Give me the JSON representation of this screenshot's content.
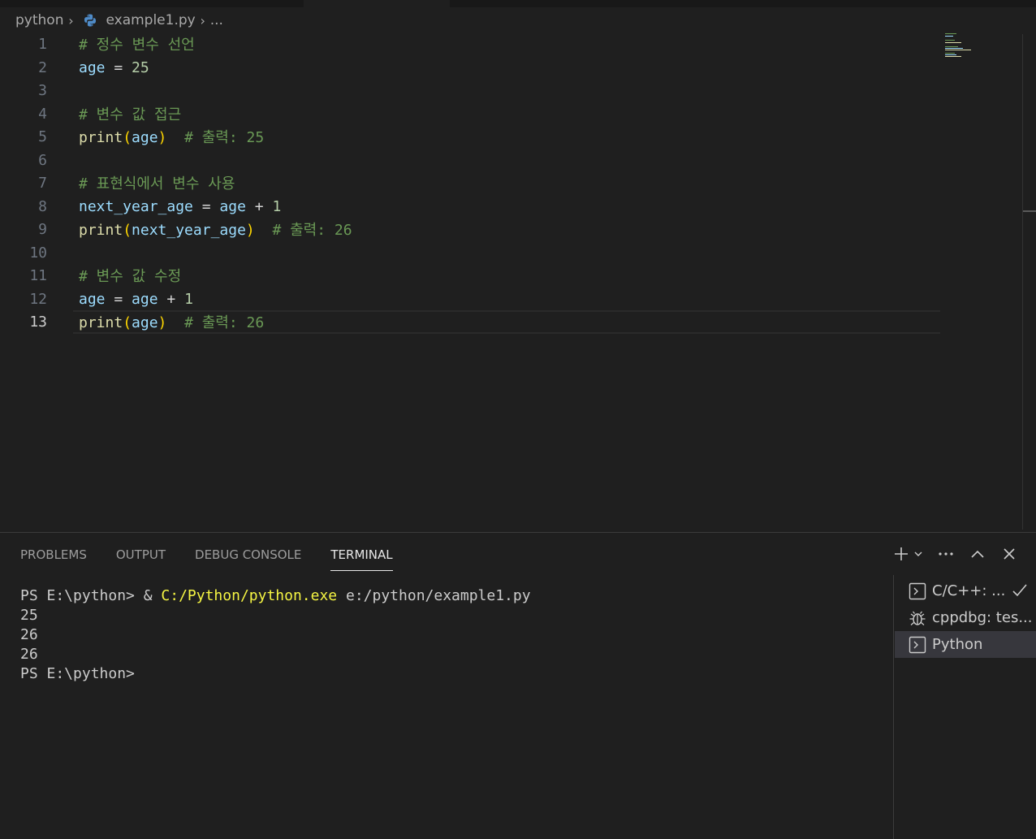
{
  "breadcrumb": {
    "folder": "python",
    "file": "example1.py",
    "more": "...",
    "file_icon": "python-file-icon"
  },
  "editor": {
    "current_line": 13,
    "lines": [
      {
        "n": "1",
        "text": "# 정수 변수 선언"
      },
      {
        "n": "2",
        "text": "age = 25"
      },
      {
        "n": "3",
        "text": ""
      },
      {
        "n": "4",
        "text": "# 변수 값 접근"
      },
      {
        "n": "5",
        "text": "print(age)  # 출력: 25"
      },
      {
        "n": "6",
        "text": ""
      },
      {
        "n": "7",
        "text": "# 표현식에서 변수 사용"
      },
      {
        "n": "8",
        "text": "next_year_age = age + 1"
      },
      {
        "n": "9",
        "text": "print(next_year_age)  # 출력: 26"
      },
      {
        "n": "10",
        "text": ""
      },
      {
        "n": "11",
        "text": "# 변수 값 수정"
      },
      {
        "n": "12",
        "text": "age = age + 1"
      },
      {
        "n": "13",
        "text": "print(age)  # 출력: 26"
      }
    ],
    "tokens": {
      "l1": "# 정수 변수 선언",
      "l2_var": "age",
      "l2_op": " = ",
      "l2_num": "25",
      "l4": "# 변수 값 접근",
      "l5_fn": "print",
      "l5_open": "(",
      "l5_arg": "age",
      "l5_close": ")",
      "l5_cmt": "  # 출력: 25",
      "l7": "# 표현식에서 변수 사용",
      "l8_var": "next_year_age",
      "l8_op": " = ",
      "l8_var2": "age",
      "l8_op2": " + ",
      "l8_num": "1",
      "l9_fn": "print",
      "l9_open": "(",
      "l9_arg": "next_year_age",
      "l9_close": ")",
      "l9_cmt": "  # 출력: 26",
      "l11": "# 변수 값 수정",
      "l12_var": "age",
      "l12_op": " = ",
      "l12_var2": "age",
      "l12_op2": " + ",
      "l12_num": "1",
      "l13_fn": "print",
      "l13_open": "(",
      "l13_arg": "age",
      "l13_close": ")",
      "l13_cmt": "  # 출력: 26"
    }
  },
  "panel": {
    "tabs": [
      "PROBLEMS",
      "OUTPUT",
      "DEBUG CONSOLE",
      "TERMINAL"
    ],
    "active_tab": "TERMINAL",
    "actions": [
      "add-terminal-icon",
      "chevron-down-icon",
      "more-icon",
      "maximize-panel-icon",
      "close-icon"
    ]
  },
  "terminal": {
    "prompt": "PS E:\\python> ",
    "cmd_amp": "& ",
    "cmd_exe": "C:/Python/python.exe",
    "cmd_arg": " e:/python/example1.py",
    "output": [
      "25",
      "26",
      "26"
    ],
    "final_prompt": "PS E:\\python>"
  },
  "terminal_list": [
    {
      "label": "C/C++: ...",
      "icon": "terminal-icon",
      "status": "check-icon"
    },
    {
      "label": "cppdbg: tes...",
      "icon": "debug-bug-icon"
    },
    {
      "label": "Python",
      "icon": "terminal-icon",
      "selected": true
    }
  ],
  "colors": {
    "background": "#1f1f1f",
    "comment": "#6a9955",
    "variable": "#9cdcfe",
    "number": "#b5cea8",
    "function": "#dcdcaa",
    "bracket": "#ffd700",
    "terminal_exe": "#f5f543"
  }
}
